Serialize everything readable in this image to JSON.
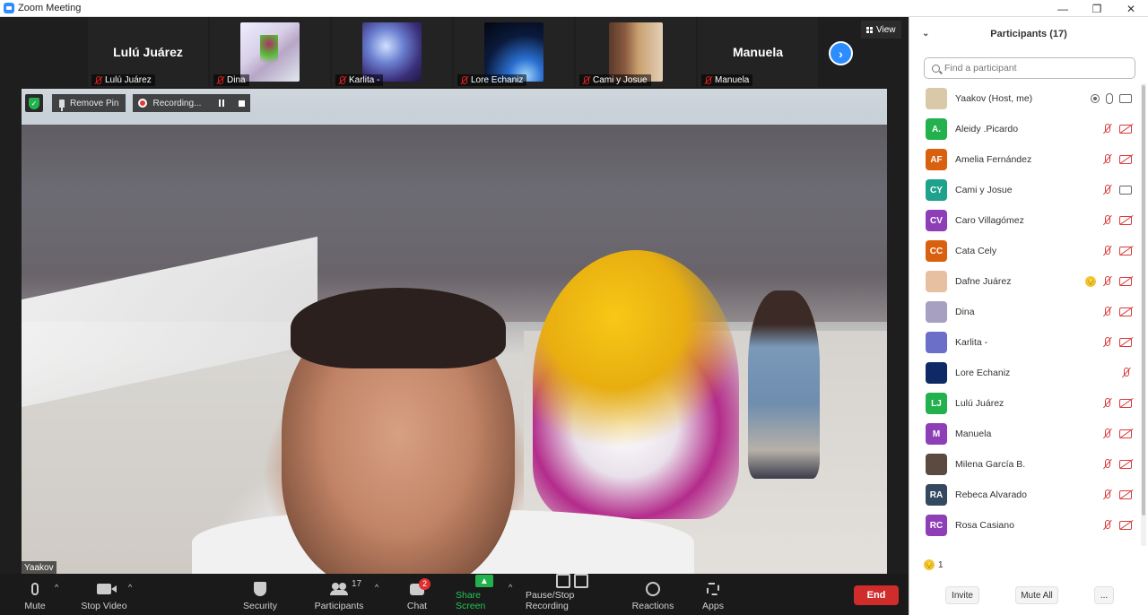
{
  "window": {
    "title": "Zoom Meeting",
    "controls": {
      "minimize": "—",
      "maximize": "❐",
      "close": "✕"
    }
  },
  "thumbnails": [
    {
      "big_text": "Lulú Juárez",
      "label": "Lulú Juárez",
      "picture": ""
    },
    {
      "big_text": "",
      "label": "Dina",
      "picture": "dina"
    },
    {
      "big_text": "",
      "label": "Karlita -",
      "picture": "karlita"
    },
    {
      "big_text": "",
      "label": "Lore Echaniz",
      "picture": "lore"
    },
    {
      "big_text": "",
      "label": "Cami y Josue",
      "picture": "cami"
    },
    {
      "big_text": "Manuela",
      "label": "Manuela",
      "picture": ""
    }
  ],
  "view_button": {
    "label": "View"
  },
  "next_button": {
    "label": "›"
  },
  "video_tools": {
    "remove_pin_label": "Remove Pin",
    "recording_label": "Recording...",
    "security_check": "✓"
  },
  "speaker_name": "Yaakov",
  "toolbar": {
    "mute_label": "Mute",
    "stop_video_label": "Stop Video",
    "security_label": "Security",
    "participants_label": "Participants",
    "participants_count": "17",
    "chat_label": "Chat",
    "chat_badge": "2",
    "share_label": "Share Screen",
    "share_icon": "▲",
    "recording_label": "Pause/Stop Recording",
    "reactions_label": "Reactions",
    "apps_label": "Apps",
    "end_label": "End",
    "caret": "^"
  },
  "panel": {
    "title": "Participants (17)",
    "collapse_icon": "⌄",
    "search_placeholder": "Find a participant",
    "participants": [
      {
        "initials": "",
        "name": "Yaakov (Host, me)",
        "color": "#d9c9a8",
        "mic": "on",
        "cam": "on",
        "recording": true,
        "emoji": false
      },
      {
        "initials": "A.",
        "name": "Aleidy .Picardo",
        "color": "#23b14d",
        "mic": "off",
        "cam": "off",
        "recording": false,
        "emoji": false
      },
      {
        "initials": "AF",
        "name": "Amelia Fernández",
        "color": "#d9600f",
        "mic": "off",
        "cam": "off",
        "recording": false,
        "emoji": false
      },
      {
        "initials": "CY",
        "name": "Cami y Josue",
        "color": "#1ea28c",
        "mic": "off",
        "cam": "on",
        "recording": false,
        "emoji": false
      },
      {
        "initials": "CV",
        "name": "Caro Villagómez",
        "color": "#8e3fb8",
        "mic": "off",
        "cam": "off",
        "recording": false,
        "emoji": false
      },
      {
        "initials": "CC",
        "name": "Cata Cely",
        "color": "#d9600f",
        "mic": "off",
        "cam": "off",
        "recording": false,
        "emoji": false
      },
      {
        "initials": "",
        "name": "Dafne Juárez",
        "color": "#e6c0a0",
        "mic": "off",
        "cam": "off",
        "recording": false,
        "emoji": true
      },
      {
        "initials": "",
        "name": "Dina",
        "color": "#a8a0c0",
        "mic": "off",
        "cam": "off",
        "recording": false,
        "emoji": false
      },
      {
        "initials": "",
        "name": "Karlita -",
        "color": "#6b6fc8",
        "mic": "off",
        "cam": "off",
        "recording": false,
        "emoji": false
      },
      {
        "initials": "",
        "name": "Lore Echaniz",
        "color": "#0d2a66",
        "mic": "off",
        "cam": "none",
        "recording": false,
        "emoji": false
      },
      {
        "initials": "LJ",
        "name": "Lulú Juárez",
        "color": "#23b14d",
        "mic": "off",
        "cam": "off",
        "recording": false,
        "emoji": false
      },
      {
        "initials": "M",
        "name": "Manuela",
        "color": "#8e3fb8",
        "mic": "off",
        "cam": "off",
        "recording": false,
        "emoji": false
      },
      {
        "initials": "",
        "name": "Milena García B.",
        "color": "#5a4a40",
        "mic": "off",
        "cam": "off",
        "recording": false,
        "emoji": false
      },
      {
        "initials": "RA",
        "name": "Rebeca Alvarado",
        "color": "#34485f",
        "mic": "off",
        "cam": "off",
        "recording": false,
        "emoji": false
      },
      {
        "initials": "RC",
        "name": "Rosa Casiano",
        "color": "#8e3fb8",
        "mic": "off",
        "cam": "off",
        "recording": false,
        "emoji": false
      }
    ],
    "emoji_glyph": "😔",
    "reaction_count": "1",
    "invite_label": "Invite",
    "mute_all_label": "Mute All",
    "more_label": "..."
  }
}
